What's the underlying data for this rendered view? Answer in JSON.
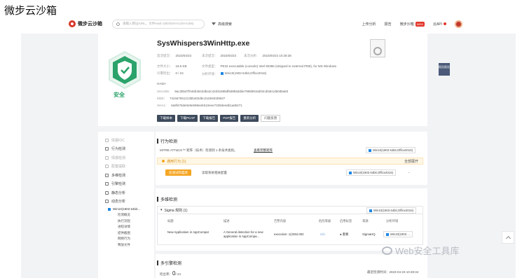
{
  "caption": "微步云沙箱",
  "header": {
    "brand": "微步云沙箱",
    "search_placeholder": "请输入网址/URL，文件Hash (MD5/SHA1/SHA256)",
    "advanced_search": "高级搜索",
    "nav": [
      "上传分析",
      "报告",
      "微步沙箱",
      "云API"
    ],
    "new_badge": "NEW"
  },
  "summary": {
    "filename": "SysWhispers3WinHttp.exe",
    "verdict": "安全",
    "first_seen_label": "首次提交：",
    "first_seen": "2023/04/23",
    "last_seen_label": "末次提交：",
    "last_seen": "2023/04/23",
    "last_analysis_label": "末次分析：",
    "last_analysis": "2023/04/23 10:28:38",
    "size_label": "文件大小：",
    "size": "18.5 KB",
    "type_label": "文件类型：",
    "type": "PE32 executable (console) Intel 80386 (stripped to external PDB), for MS Windows",
    "detect_label": "引擎检出：",
    "detect": "0 / 24",
    "env_label": "分析环境：",
    "env": "Win10(1903 64bit,Office2016)",
    "hash_title": "HASH",
    "sha256_label": "SHA256：",
    "sha256": "9ac3bbd7f046b3542dba3c42d31888df5d8b6ddde79889916d03cd0de1d50d6a83",
    "md5_label": "MD5：",
    "md5": "74c567061213bb402d5c21159403963? ",
    "sha1_label": "SHA1：",
    "sha1": "6a9f476de0e8e599eeb510eee7339deedb1ad6471",
    "side_tag": "报告报告"
  },
  "actions": [
    "下载样本",
    "下载PCAP",
    "下载报告",
    "PDF报告",
    "重新分析",
    "问题反馈"
  ],
  "sidebar": {
    "items": [
      "情报IOC",
      "行为检测",
      "情报检测",
      "配置提取",
      "多维检测",
      "引擎检测",
      "静态分析",
      "动态分析"
    ],
    "env": "Win10(1903 64bit...",
    "sub_items": [
      "检测概览",
      "执行流程",
      "进程详情",
      "提供截图",
      "网络行为",
      "释放文件"
    ]
  },
  "behavior": {
    "title": "行为检测",
    "mitre_text": "MITRE ATT&CK™ 矩阵（技术）检测到 1 条技术类别。",
    "mitre_link": "查看完整矩阵",
    "env_select": "Win10(1903 64bit,Office2016)",
    "warning": "通用行为 (1)",
    "expand": "全部展开",
    "tag": "反调试和篡改",
    "tag_desc": "读取系统相关配置",
    "env_select2": "Win10(1903 64bit,Office2016)"
  },
  "multi": {
    "title": "多维检测",
    "sigma_title": "Sigma 规则 (1)",
    "env_select": "Win10(1903 64bit,Office2016)",
    "columns": [
      "标题",
      "描述",
      "告警内容",
      "危险等级",
      "启用标签",
      "来源",
      "分析环境"
    ],
    "row": {
      "title": "New Application in AppCompat",
      "desc": "A General detection for a new application in AppCompa...",
      "alert": "execution: 1(2284.002",
      "level": "info",
      "tag": "● 重要",
      "source": "SigmaHQ",
      "env": "Win10(1903 ..."
    }
  },
  "engine": {
    "title": "多引擎检测",
    "detect_label": "检出率：",
    "detect_value": "0",
    "detect_total": "/ 24",
    "latest_label": "最近检测时间：",
    "latest": "2023-04-23 10:28:34"
  },
  "watermark": "Web安全工具库",
  "colors": {
    "safe": "#2ba36a",
    "accent": "#e2362b",
    "dark_btn": "#3d4a5c"
  }
}
